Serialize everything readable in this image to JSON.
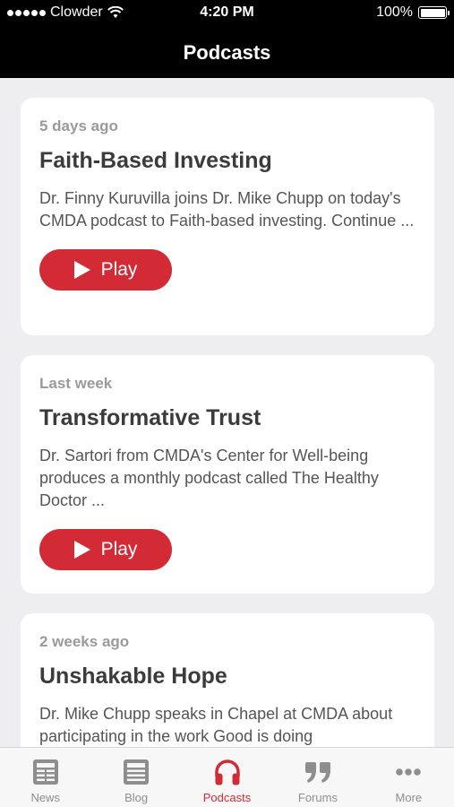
{
  "status": {
    "carrier": "Clowder",
    "time": "4:20 PM",
    "battery": "100%"
  },
  "nav": {
    "title": "Podcasts"
  },
  "podcasts": [
    {
      "date": "5 days ago",
      "title": "Faith-Based Investing",
      "description": "Dr. Finny Kuruvilla joins Dr. Mike Chupp on today's CMDA podcast to Faith-based investing. Continue ...",
      "play_label": "Play"
    },
    {
      "date": "Last week",
      "title": "Transformative Trust",
      "description": "Dr. Sartori from CMDA's Center for Well-being produces a monthly podcast called The Healthy Doctor ...",
      "play_label": "Play"
    },
    {
      "date": "2 weeks ago",
      "title": "Unshakable Hope",
      "description": "Dr. Mike Chupp speaks in Chapel at CMDA about participating in the work Good is doing"
    }
  ],
  "tabs": [
    {
      "label": "News",
      "icon": "newspaper-icon"
    },
    {
      "label": "Blog",
      "icon": "document-icon"
    },
    {
      "label": "Podcasts",
      "icon": "headphones-icon",
      "active": true
    },
    {
      "label": "Forums",
      "icon": "quote-icon"
    },
    {
      "label": "More",
      "icon": "more-dots-icon"
    }
  ],
  "colors": {
    "accent": "#d22b36",
    "background": "#eeeef1",
    "bar": "#000000"
  }
}
